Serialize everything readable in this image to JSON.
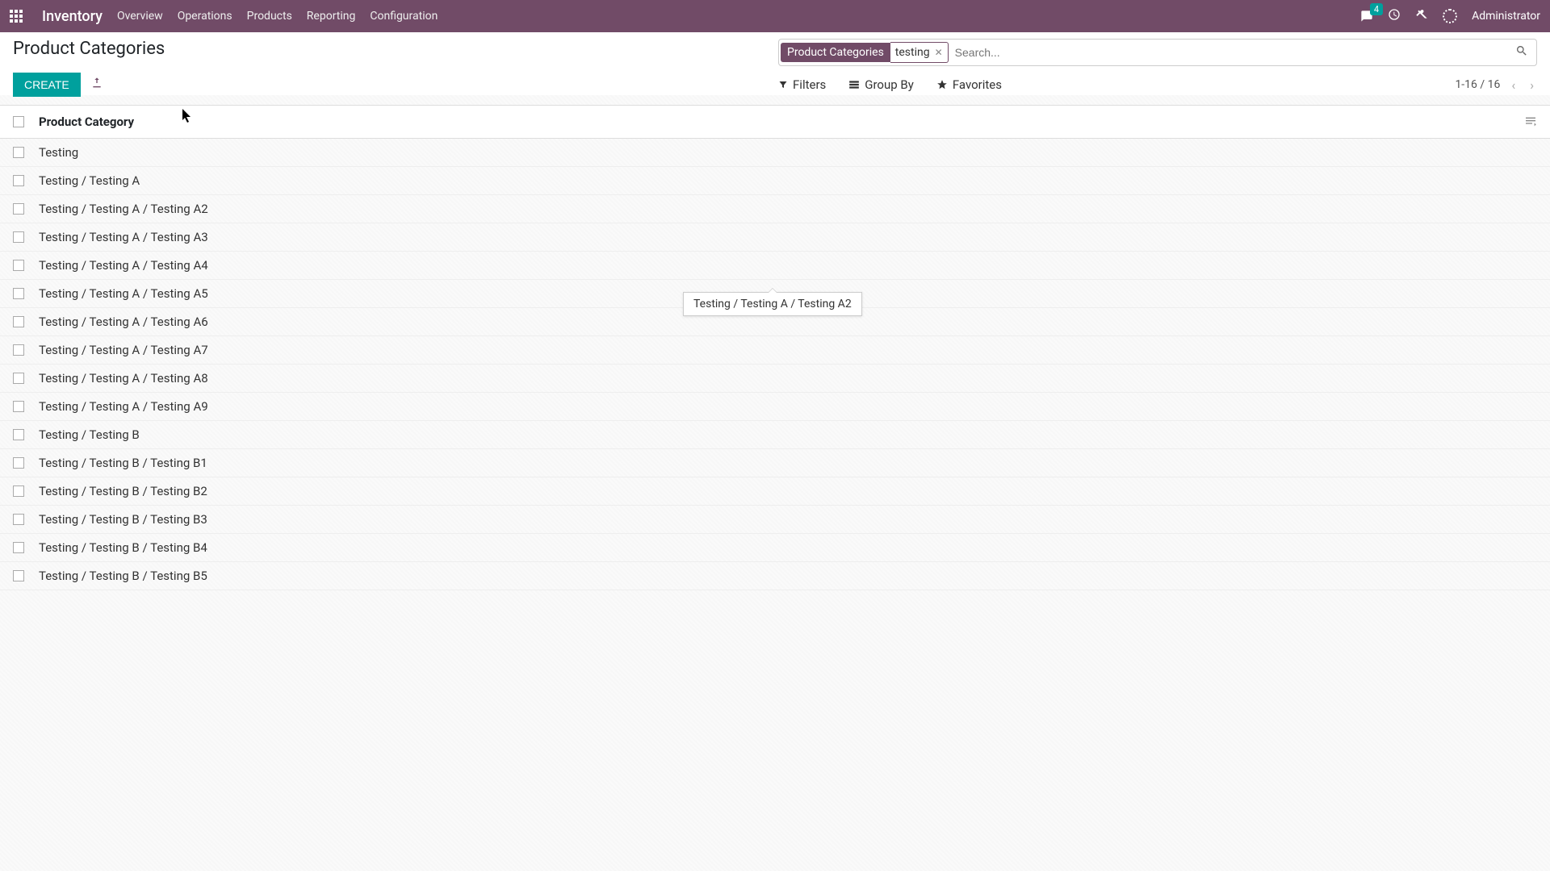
{
  "nav": {
    "brand": "Inventory",
    "items": [
      "Overview",
      "Operations",
      "Products",
      "Reporting",
      "Configuration"
    ],
    "badge": "4",
    "user": "Administrator"
  },
  "page": {
    "title": "Product Categories",
    "create": "CREATE"
  },
  "search": {
    "facet": "Product Categories",
    "value": "testing",
    "placeholder": "Search..."
  },
  "toolbar": {
    "filters": "Filters",
    "groupby": "Group By",
    "favorites": "Favorites",
    "pager": "1-16 / 16"
  },
  "list": {
    "header": "Product Category",
    "rows": [
      "Testing",
      "Testing / Testing A",
      "Testing / Testing A / Testing A2",
      "Testing / Testing A / Testing A3",
      "Testing / Testing A / Testing A4",
      "Testing / Testing A / Testing A5",
      "Testing / Testing A / Testing A6",
      "Testing / Testing A / Testing A7",
      "Testing / Testing A / Testing A8",
      "Testing / Testing A / Testing A9",
      "Testing / Testing B",
      "Testing / Testing B / Testing B1",
      "Testing / Testing B / Testing B2",
      "Testing / Testing B / Testing B3",
      "Testing / Testing B / Testing B4",
      "Testing / Testing B / Testing B5"
    ]
  },
  "tooltip": "Testing / Testing A / Testing A2"
}
